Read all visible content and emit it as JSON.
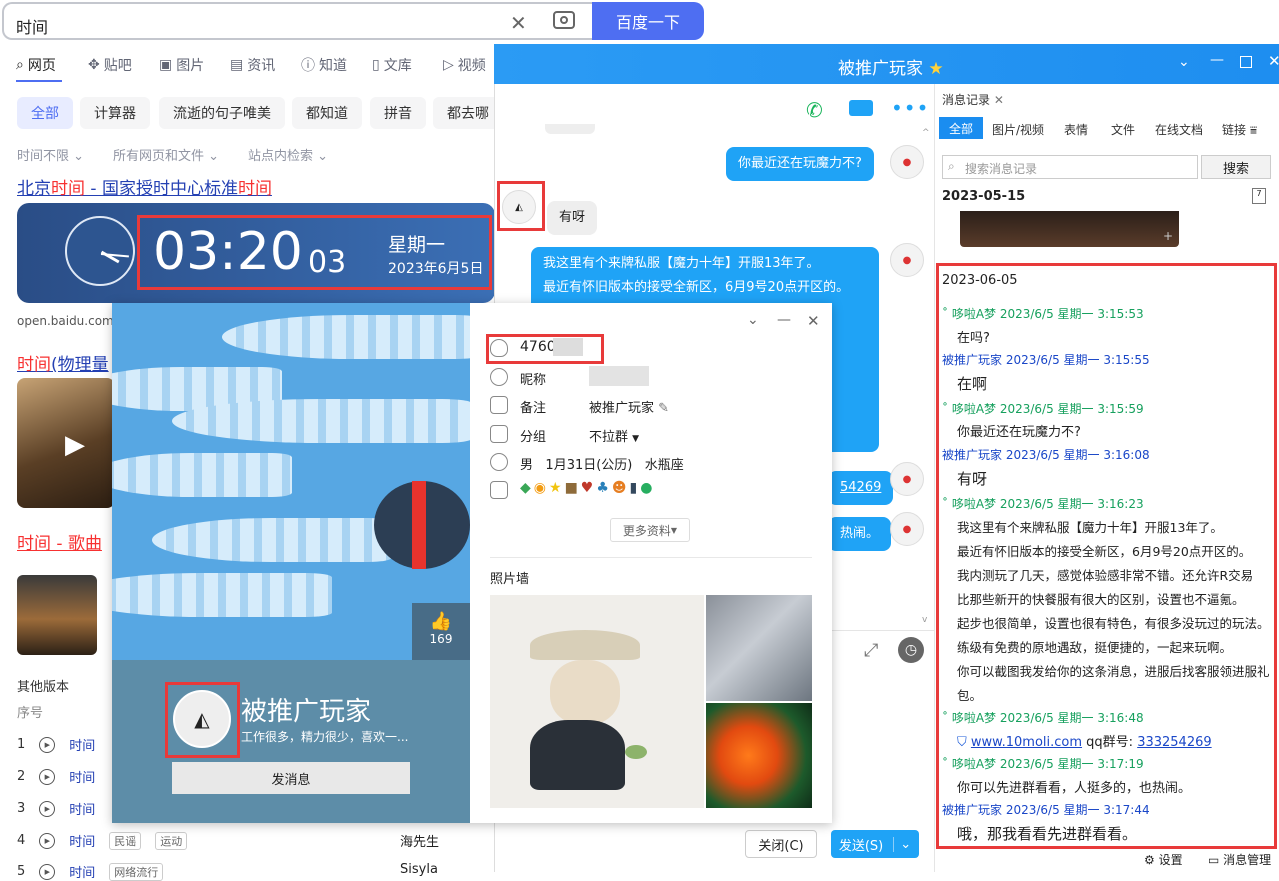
{
  "search": {
    "query": "时间",
    "button": "百度一下"
  },
  "tabs": [
    "网页",
    "贴吧",
    "图片",
    "资讯",
    "知道",
    "文库",
    "视频"
  ],
  "chips": [
    "全部",
    "计算器",
    "流逝的句子唯美",
    "都知道",
    "拼音",
    "都去哪"
  ],
  "filters": [
    "时间不限",
    "所有网页和文件",
    "站点内检索"
  ],
  "results": {
    "r1_a": "北京",
    "r1_b": "时间",
    "r1_c": " - 国家授时中心标准",
    "r1_d": "时间",
    "clock_time": "03:20",
    "clock_sec": "03",
    "clock_weekday": "星期一",
    "clock_date": "2023年6月5日",
    "r1_url": "open.baidu.com/",
    "r2_a": "时间",
    "r2_b": "(物理量",
    "r3": "时间 - 歌曲",
    "other_versions": "其他版本",
    "seq": "序号",
    "songs": [
      {
        "n": "1",
        "t": "时间"
      },
      {
        "n": "2",
        "t": "时间"
      },
      {
        "n": "3",
        "t": "时间"
      },
      {
        "n": "4",
        "t": "时间",
        "tags": [
          "民谣",
          "运动"
        ],
        "artist": "海先生"
      },
      {
        "n": "5",
        "t": "时间",
        "tags": [
          "网络流行"
        ],
        "artist": "Sisyla"
      }
    ]
  },
  "chat": {
    "title": "被推广玩家",
    "messages": [
      {
        "from": "me",
        "text": "你最近还在玩魔力不?"
      },
      {
        "from": "them",
        "text": "有呀"
      },
      {
        "from": "me",
        "lines": [
          "我这里有个来牌私服【魔力十年】开服13年了。",
          "最近有怀旧版本的接受全新区，6月9号20点开区的。"
        ]
      },
      {
        "from": "me",
        "text": "54269"
      },
      {
        "from": "me",
        "text": "热闹。"
      }
    ],
    "close_btn": "关闭(C)",
    "send_btn": "发送(S)"
  },
  "history": {
    "tab_title": "消息记录",
    "filters": [
      "全部",
      "图片/视频",
      "表情",
      "文件",
      "在线文档",
      "链接"
    ],
    "search_placeholder": "搜索消息记录",
    "search_btn": "搜索",
    "date1": "2023-05-15",
    "date2": "2023-06-05",
    "entries": [
      {
        "meta": "˚ 哆啦A梦 2023/6/5 星期一 3:15:53",
        "kind": "g",
        "text": "在吗?"
      },
      {
        "meta": "被推广玩家 2023/6/5 星期一 3:15:55",
        "kind": "b",
        "text": "在啊"
      },
      {
        "meta": "˚ 哆啦A梦 2023/6/5 星期一 3:15:59",
        "kind": "g",
        "text": "你最近还在玩魔力不?"
      },
      {
        "meta": "被推广玩家 2023/6/5 星期一 3:16:08",
        "kind": "b",
        "text": "有呀"
      },
      {
        "meta": "˚ 哆啦A梦 2023/6/5 星期一 3:16:23",
        "kind": "g"
      }
    ],
    "long_msg": [
      "我这里有个来牌私服【魔力十年】开服13年了。",
      "最近有怀旧版本的接受全新区，6月9号20点开区的。",
      "我内测玩了几天，感觉体验感非常不错。还允许R交易",
      "比那些新开的快餐服有很大的区别，设置也不逼氪。",
      "起步也很简单，设置也很有特色，有很多没玩过的玩法。",
      "练级有免费的原地遇敌，挺便捷的，一起来玩啊。",
      "你可以截图我发给你的这条消息，进服后找客服领进服礼",
      "包。"
    ],
    "e6_meta": "˚ 哆啦A梦 2023/6/5 星期一 3:16:48",
    "e6_link": "www.10moli.com",
    "e6_mid": " qq群号: ",
    "e6_qq": "333254269",
    "e7_meta": "˚ 哆啦A梦 2023/6/5 星期一 3:17:19",
    "e7_text": "你可以先进群看看，人挺多的，也热闹。",
    "e8_meta": "被推广玩家 2023/6/5 星期一 3:17:44",
    "e8_text": "哦，那我看看先进群看看。",
    "settings": "设置",
    "manage": "消息管理"
  },
  "profile": {
    "qq": "4760",
    "nick_label": "昵称",
    "note_label": "备注",
    "note": "被推广玩家",
    "group_label": "分组",
    "group": "不拉群",
    "gender": "男",
    "birthday": "1月31日(公历)",
    "zodiac": "水瓶座",
    "more": "更多资料",
    "photos": "照片墙",
    "likes": "169",
    "name": "被推广玩家",
    "sign": "工作很多，精力很少，喜欢一...",
    "send_msg": "发消息"
  }
}
